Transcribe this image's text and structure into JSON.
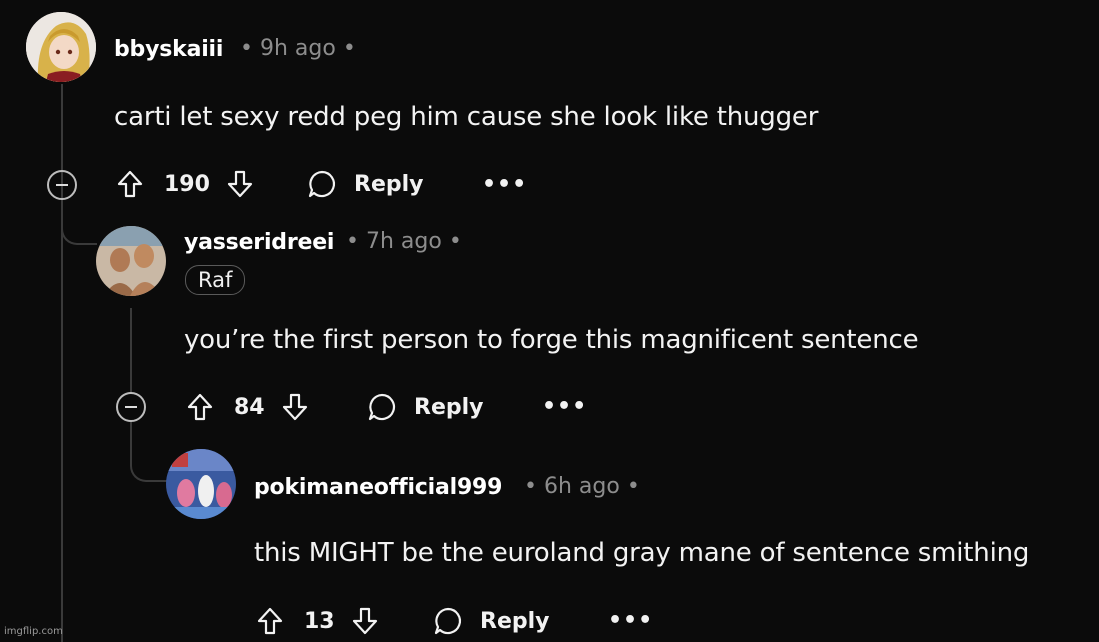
{
  "comments": [
    {
      "username": "bbyskaiii",
      "time": "9h ago",
      "text": "carti let sexy redd peg him cause she look like thugger",
      "upvotes": "190",
      "reply_label": "Reply",
      "more_label": "•••"
    },
    {
      "username": "yasseridreei",
      "time": "7h ago",
      "flair": "Raf",
      "text": "you’re the first person to forge this magnificent sentence",
      "upvotes": "84",
      "reply_label": "Reply",
      "more_label": "•••"
    },
    {
      "username": "pokimaneofficial999",
      "time": "6h ago",
      "text": "this MIGHT be the euroland gray mane of sentence smithing",
      "upvotes": "13",
      "reply_label": "Reply",
      "more_label": "•••"
    }
  ],
  "bullet": "•",
  "watermark": "imgflip.com"
}
